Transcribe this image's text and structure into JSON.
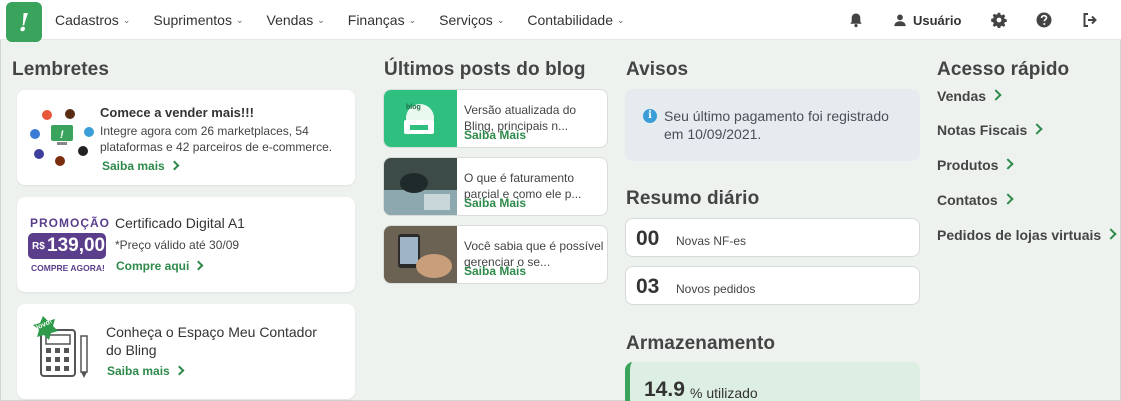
{
  "nav": {
    "logo": "!",
    "menu": [
      {
        "label": "Cadastros"
      },
      {
        "label": "Suprimentos"
      },
      {
        "label": "Vendas"
      },
      {
        "label": "Finanças"
      },
      {
        "label": "Serviços"
      },
      {
        "label": "Contabilidade"
      }
    ],
    "user_label": "Usuário"
  },
  "lembretes": {
    "title": "Lembretes",
    "card1": {
      "title": "Comece a vender mais!!!",
      "text": "Integre agora com 26 marketplaces, 54 plataformas e 42 parceiros de e-commerce.",
      "link": "Saiba mais"
    },
    "card2": {
      "promo_word": "PROMOÇÃO",
      "price_currency": "R$",
      "price": "139,00",
      "promo_cta": "COMPRE AGORA!",
      "title": "Certificado Digital A1",
      "text": "*Preço válido até 30/09",
      "link": "Compre aqui"
    },
    "card3": {
      "badge": "Novo!",
      "title": "Conheça o Espaço Meu Contador do Bling",
      "link": "Saiba mais"
    }
  },
  "blog": {
    "title": "Últimos posts do blog",
    "posts": [
      {
        "text": "Versão atualizada do Bling, principais n...",
        "more": "Saiba Mais"
      },
      {
        "text": "O que é faturamento parcial e como ele p...",
        "more": "Saiba Mais"
      },
      {
        "text": "Você sabia que é possível gerenciar o se...",
        "more": "Saiba Mais"
      }
    ],
    "thumb1_label": "blog"
  },
  "avisos": {
    "title": "Avisos",
    "text": "Seu último pagamento foi registrado em 10/09/2021."
  },
  "resumo": {
    "title": "Resumo diário",
    "items": [
      {
        "num": "00",
        "label": "Novas NF-es"
      },
      {
        "num": "03",
        "label": "Novos pedidos"
      }
    ]
  },
  "armazenamento": {
    "title": "Armazenamento",
    "value": "14.9",
    "unit": "% utilizado",
    "level": 0.149
  },
  "acesso": {
    "title": "Acesso rápido",
    "links": [
      {
        "label": "Vendas"
      },
      {
        "label": "Notas Fiscais"
      },
      {
        "label": "Produtos"
      },
      {
        "label": "Contatos"
      },
      {
        "label": "Pedidos de lojas virtuais"
      }
    ]
  },
  "colors": {
    "brand_green": "#3aa45c",
    "link_green": "#2e8a4a",
    "promo_purple": "#5a3e8c"
  }
}
